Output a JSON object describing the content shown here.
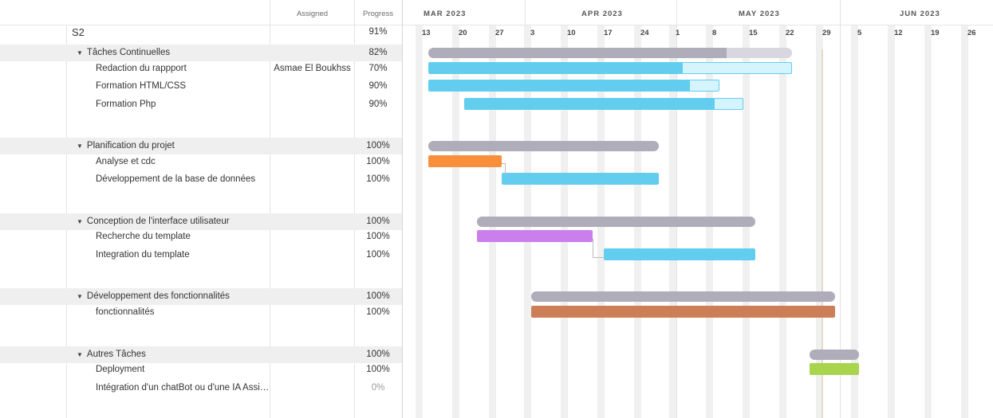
{
  "header": {
    "assigned_label": "Assigned",
    "progress_label": "Progress",
    "months": [
      "MAR 2023",
      "APR 2023",
      "MAY 2023",
      "JUN 2023"
    ],
    "days": [
      "13",
      "20",
      "27",
      "3",
      "10",
      "17",
      "24",
      "1",
      "8",
      "15",
      "22",
      "29",
      "5",
      "12",
      "19",
      "26"
    ]
  },
  "project": {
    "name": "S2",
    "progress": "91%"
  },
  "groups": [
    {
      "name": "Tâches Continuelles",
      "progress": "82%",
      "bar_color": "#aeadb9",
      "tasks": [
        {
          "name": "Redaction du rappport",
          "assigned": "Asmae El Boukhss",
          "progress": "70%",
          "color": "#62cdee"
        },
        {
          "name": "Formation HTML/CSS",
          "assigned": "",
          "progress": "90%",
          "color": "#62cdee"
        },
        {
          "name": "Formation Php",
          "assigned": "",
          "progress": "90%",
          "color": "#62cdee"
        }
      ]
    },
    {
      "name": "Planification du projet",
      "progress": "100%",
      "bar_color": "#aeadb9",
      "tasks": [
        {
          "name": "Analyse et cdc",
          "assigned": "",
          "progress": "100%",
          "color": "#f98f3c"
        },
        {
          "name": "Développement de la base de données",
          "assigned": "",
          "progress": "100%",
          "color": "#62cdee"
        }
      ]
    },
    {
      "name": "Conception de l'interface utilisateur",
      "progress": "100%",
      "bar_color": "#aeadb9",
      "tasks": [
        {
          "name": "Recherche du template",
          "assigned": "",
          "progress": "100%",
          "color": "#cb7fec"
        },
        {
          "name": "Integration du template",
          "assigned": "",
          "progress": "100%",
          "color": "#62cdee"
        }
      ]
    },
    {
      "name": "Développement des fonctionnalités",
      "progress": "100%",
      "bar_color": "#aeadb9",
      "tasks": [
        {
          "name": "fonctionnalités",
          "assigned": "",
          "progress": "100%",
          "color": "#cc7f57"
        }
      ]
    },
    {
      "name": "Autres Tâches",
      "progress": "100%",
      "bar_color": "#aeadb9",
      "tasks": [
        {
          "name": "Deployment",
          "assigned": "",
          "progress": "100%",
          "color": "#a8d44e"
        },
        {
          "name": "Intégration d'un chatBot ou d'une IA Assi…",
          "assigned": "",
          "progress": "0%",
          "color": "#62cdee"
        }
      ]
    }
  ]
}
